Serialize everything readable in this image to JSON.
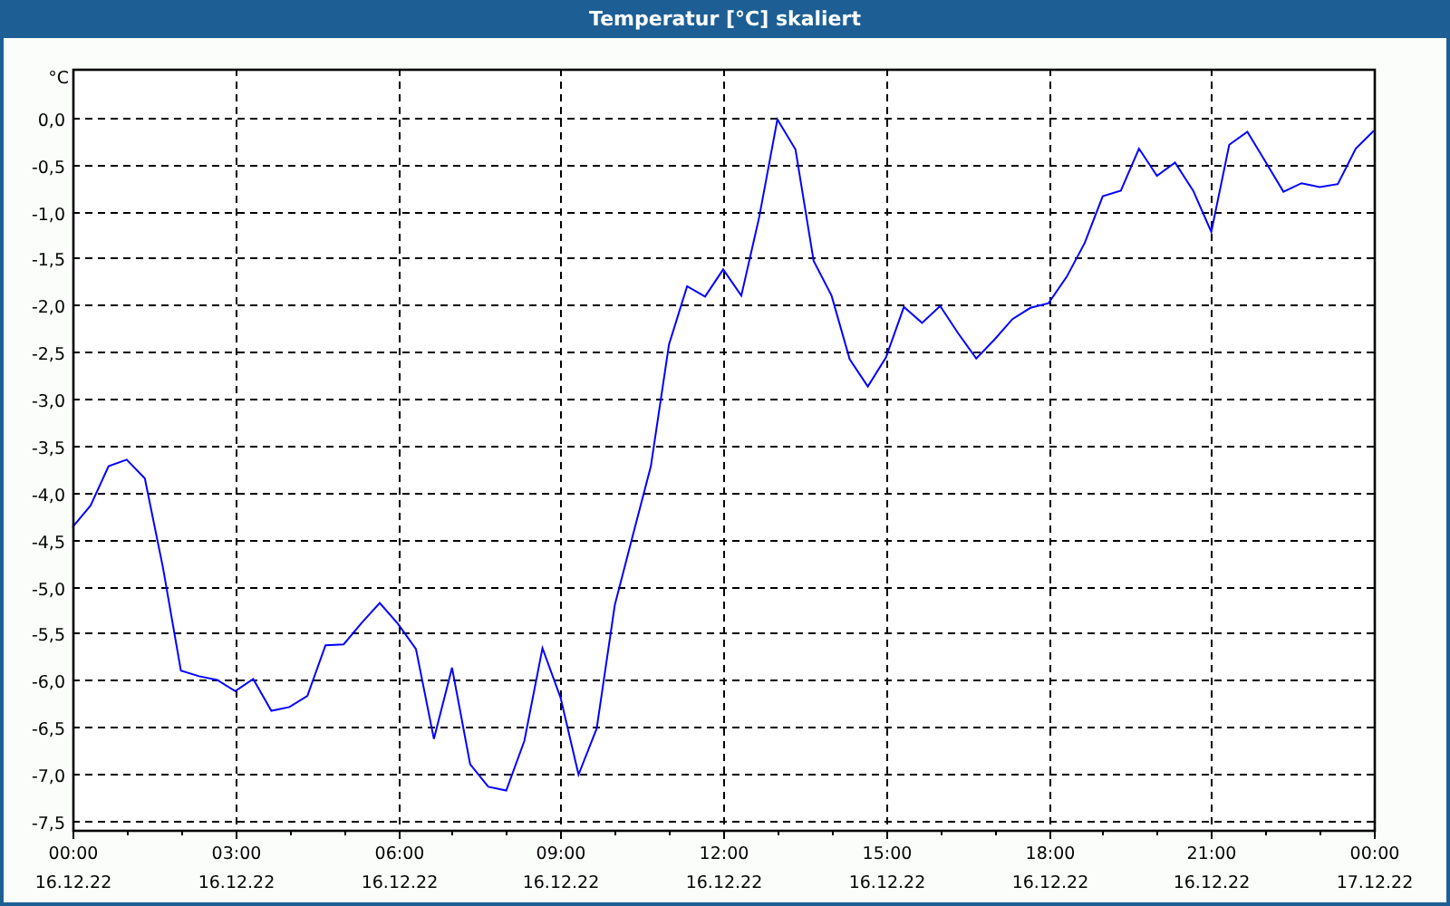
{
  "window": {
    "title": "Temperatur [°C] skaliert"
  },
  "chart_data": {
    "type": "line",
    "grid": true,
    "ylabel": "°C",
    "ylim": [
      -7.6,
      0.52
    ],
    "categories": [
      "00:00 16.12.22",
      null,
      null,
      null,
      null,
      null,
      null,
      null,
      null,
      "03:00 16.12.22",
      null,
      null,
      null,
      null,
      null,
      null,
      null,
      null,
      "06:00 16.12.22",
      null,
      null,
      null,
      null,
      null,
      null,
      null,
      null,
      "09:00 16.12.22",
      null,
      null,
      null,
      null,
      null,
      null,
      null,
      null,
      "12:00 16.12.22",
      null,
      null,
      null,
      null,
      null,
      null,
      null,
      null,
      "15:00 16.12.22",
      null,
      null,
      null,
      null,
      null,
      null,
      null,
      null,
      "18:00 16.12.22",
      null,
      null,
      null,
      null,
      null,
      null,
      null,
      null,
      "21:00 16.12.22",
      null,
      null,
      null,
      null,
      null,
      null,
      null,
      null,
      "00:00 17.12.22"
    ],
    "yticks": [
      {
        "value": 0,
        "label": "0,0"
      },
      {
        "value": -0.5,
        "label": "-0,5"
      },
      {
        "value": -1,
        "label": "-1,0"
      },
      {
        "value": -1.5,
        "label": "-1,5"
      },
      {
        "value": -2,
        "label": "-2,0"
      },
      {
        "value": -2.5,
        "label": "-2,5"
      },
      {
        "value": -3,
        "label": "-3,0"
      },
      {
        "value": -3.5,
        "label": "-3,5"
      },
      {
        "value": -4,
        "label": "-4,0"
      },
      {
        "value": -4.5,
        "label": "-4,5"
      },
      {
        "value": -5,
        "label": "-5,0"
      },
      {
        "value": -5.5,
        "label": "-5,5"
      },
      {
        "value": -6,
        "label": "-6,0"
      },
      {
        "value": -6.5,
        "label": "-6,5"
      },
      {
        "value": -7,
        "label": "-7,0"
      },
      {
        "value": -7.5,
        "label": "-7,5"
      }
    ],
    "series": [
      {
        "color": "#0000ff",
        "values": [
          -4.37,
          -4.14,
          -3.72,
          -3.65,
          -3.85,
          -4.8,
          -5.9,
          -5.96,
          -6.0,
          -6.12,
          -5.99,
          -6.33,
          -6.29,
          -6.17,
          -5.63,
          -5.62,
          -5.39,
          -5.18,
          -5.4,
          -5.67,
          -6.63,
          -5.87,
          -6.9,
          -7.14,
          -7.18,
          -6.65,
          -5.66,
          -6.19,
          -7.01,
          -6.52,
          -5.2,
          -4.46,
          -3.72,
          -2.42,
          -1.8,
          -1.91,
          -1.62,
          -1.9,
          -1.06,
          -0.02,
          -0.34,
          -1.53,
          -1.9,
          -2.58,
          -2.87,
          -2.56,
          -2.02,
          -2.19,
          -2.01,
          -2.3,
          -2.57,
          -2.37,
          -2.15,
          -2.03,
          -1.98,
          -1.7,
          -1.34,
          -0.84,
          -0.78,
          -0.33,
          -0.62,
          -0.48,
          -0.78,
          -1.22,
          -0.29,
          -0.15,
          -0.47,
          -0.79,
          -0.7,
          -0.74,
          -0.71,
          -0.33,
          -0.14
        ]
      }
    ]
  }
}
